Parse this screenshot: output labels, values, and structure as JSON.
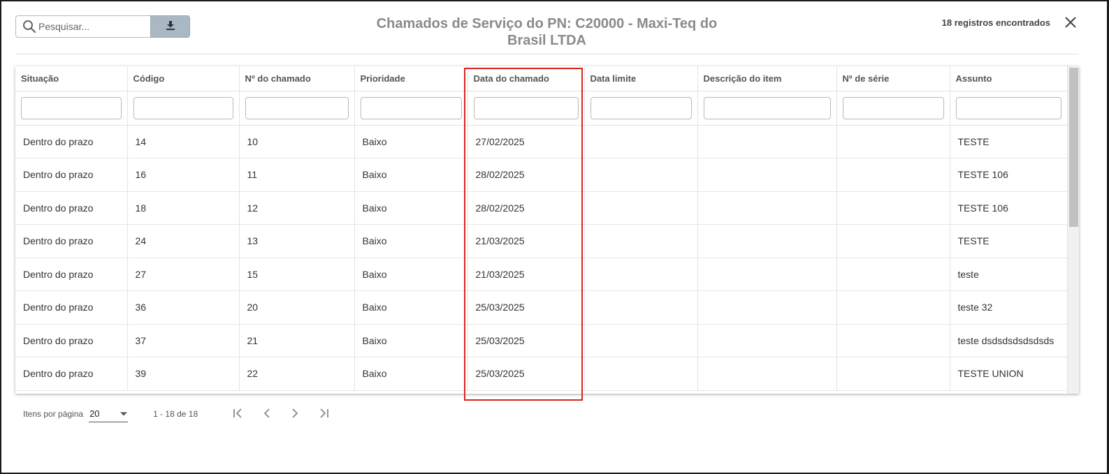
{
  "header": {
    "search_placeholder": "Pesquisar...",
    "title": "Chamados de Serviço do PN: C20000 - Maxi-Teq do Brasil LTDA",
    "count": "18 registros encontrados"
  },
  "table": {
    "columns": [
      "Situação",
      "Código",
      "Nº do chamado",
      "Prioridade",
      "Data do chamado",
      "Data limite",
      "Descrição do item",
      "Nº de série",
      "Assunto"
    ],
    "rows": [
      [
        "Dentro do prazo",
        "14",
        "10",
        "Baixo",
        "27/02/2025",
        "",
        "",
        "",
        "TESTE"
      ],
      [
        "Dentro do prazo",
        "16",
        "11",
        "Baixo",
        "28/02/2025",
        "",
        "",
        "",
        "TESTE 106"
      ],
      [
        "Dentro do prazo",
        "18",
        "12",
        "Baixo",
        "28/02/2025",
        "",
        "",
        "",
        "TESTE 106"
      ],
      [
        "Dentro do prazo",
        "24",
        "13",
        "Baixo",
        "21/03/2025",
        "",
        "",
        "",
        "TESTE"
      ],
      [
        "Dentro do prazo",
        "27",
        "15",
        "Baixo",
        "21/03/2025",
        "",
        "",
        "",
        "teste"
      ],
      [
        "Dentro do prazo",
        "36",
        "20",
        "Baixo",
        "25/03/2025",
        "",
        "",
        "",
        "teste 32"
      ],
      [
        "Dentro do prazo",
        "37",
        "21",
        "Baixo",
        "25/03/2025",
        "",
        "",
        "",
        "teste dsdsdsdsdsdsds"
      ],
      [
        "Dentro do prazo",
        "39",
        "22",
        "Baixo",
        "25/03/2025",
        "",
        "",
        "",
        "TESTE UNION"
      ]
    ],
    "highlighted_column": "Data do chamado"
  },
  "footer": {
    "items_per_page_label": "Itens por página",
    "items_per_page_value": "20",
    "range_label": "1 - 18 de 18"
  },
  "icons": {
    "search": "search-icon",
    "download": "download-icon",
    "close": "close-icon",
    "first": "first-page-icon",
    "prev": "previous-page-icon",
    "next": "next-page-icon",
    "last": "last-page-icon"
  },
  "colors": {
    "download_button": "#a9b8c3",
    "highlight_border": "#d9241d",
    "title_text": "#8a8a8a"
  }
}
